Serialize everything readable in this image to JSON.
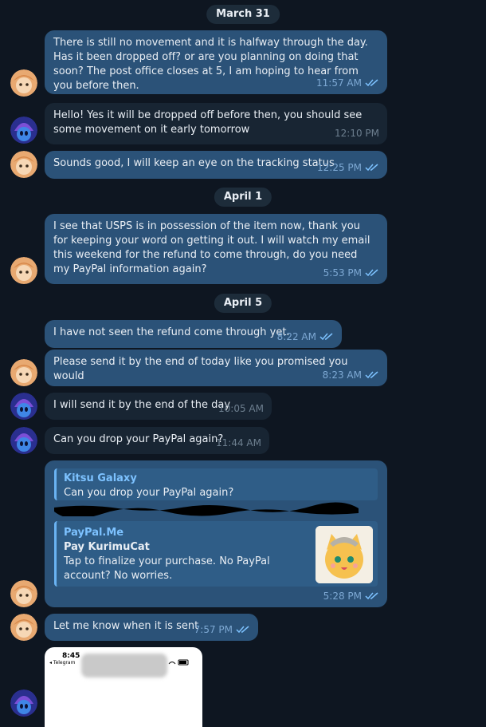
{
  "dates": [
    "March 31",
    "April 1",
    "April 5"
  ],
  "messages": [
    {
      "text": "There is still no movement and it is halfway through the day. Has it been dropped off? or are you planning on doing that soon? The post office closes at 5, I am hoping to hear from you before then.",
      "time": "11:57 AM"
    },
    {
      "text": "Hello! Yes it will be dropped off before then, you should see some movement on it early tomorrow",
      "time": "12:10 PM"
    },
    {
      "text": "Sounds good, I will keep an eye on the tracking status",
      "time": "12:25 PM"
    },
    {
      "text": "I see that USPS is in possession of the item now, thank you for keeping your word on getting it out. I will watch my email this weekend for the refund to come through, do you need my PayPal information again?",
      "time": "5:53 PM"
    },
    {
      "text": "I have not seen the refund come through yet.",
      "time": "8:22 AM"
    },
    {
      "text": "Please send it by the end of today like you promised you would",
      "time": "8:23 AM"
    },
    {
      "text": "I will send it by the end of the day",
      "time": "10:05 AM"
    },
    {
      "text": "Can you drop your PayPal again?",
      "time": "11:44 AM"
    },
    {
      "time": "5:28 PM"
    },
    {
      "text": "Let me know when it is sent",
      "time": "7:57 PM"
    }
  ],
  "reply": {
    "quote_name": "Kitsu Galaxy",
    "quote_text": "Can you drop your PayPal again?",
    "preview_site": "PayPal.Me",
    "preview_title": "Pay KurimuCat",
    "preview_desc": "Tap to finalize your purchase. No PayPal account? No worries."
  },
  "screenshot": {
    "status_time": "8:45",
    "back_label": "◂ Telegram"
  },
  "colors": {
    "background": "#0e1621",
    "outgoing_bubble": "#2b5278",
    "incoming_bubble": "#182533",
    "accent": "#6ab3f3"
  }
}
